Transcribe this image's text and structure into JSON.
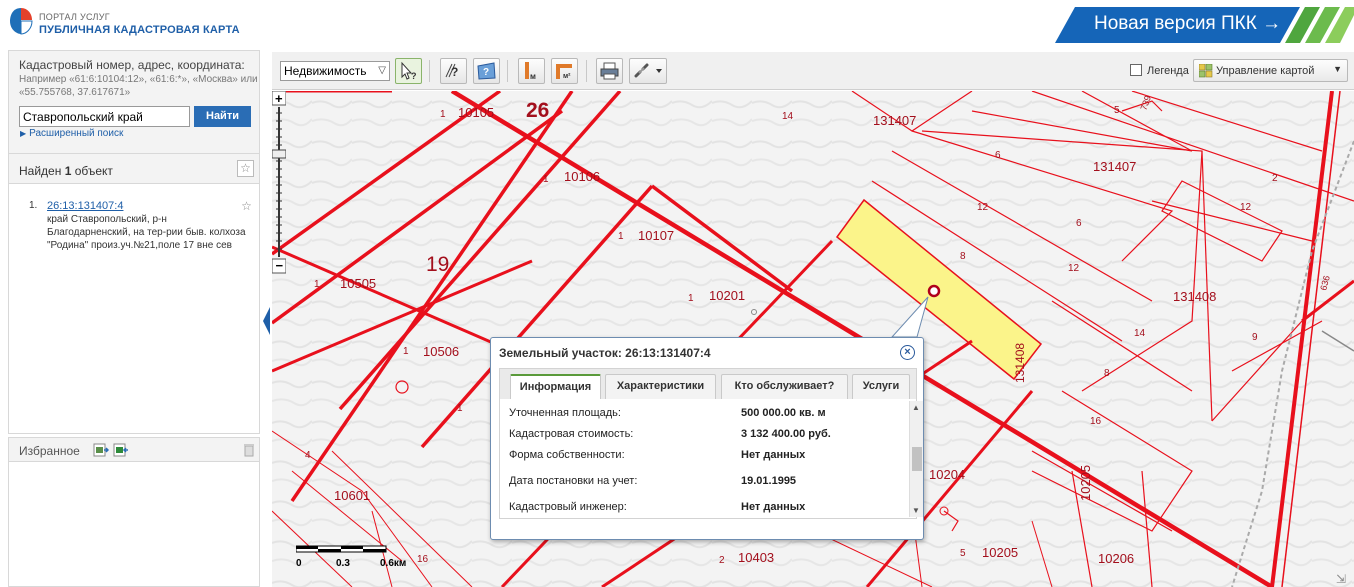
{
  "header": {
    "portal_line1": "ПОРТАЛ УСЛУГ",
    "portal_line2": "ПУБЛИЧНАЯ КАДАСТРОВАЯ КАРТА",
    "banner_label": "Новая версия ПКК →",
    "banner_colors": [
      "#1565b8",
      "#4fa63e"
    ]
  },
  "search": {
    "title": "Кадастровый номер, адрес, координата:",
    "hint": "Например «61:6:10104:12», «61:6:*», «Москва» или «55.755768, 37.617671»",
    "input_value": "Ставропольский край",
    "button_label": "Найти",
    "advanced_label": "Расширенный поиск"
  },
  "results": {
    "title_prefix": "Найден ",
    "count": "1",
    "title_suffix": " объект",
    "items": [
      {
        "num": "1.",
        "cadastral": "26:13:131407:4",
        "address": "край Ставропольский, р-н Благодарненский, на тер-рии быв. колхоза \"Родина\" произ.уч.№21,поле 17 вне сев"
      }
    ]
  },
  "favorites": {
    "title": "Избранное"
  },
  "toolbar": {
    "layer_select": "Недвижимость",
    "legend_label": "Легенда",
    "map_control_label": "Управление картой"
  },
  "map": {
    "labels": [
      {
        "text": "26",
        "big": true
      },
      {
        "text": "19",
        "big": true
      },
      {
        "text": "10105"
      },
      {
        "text": "10106"
      },
      {
        "text": "10107"
      },
      {
        "text": "10201"
      },
      {
        "text": "10505"
      },
      {
        "text": "10506"
      },
      {
        "text": "10601"
      },
      {
        "text": "10204"
      },
      {
        "text": "10205"
      },
      {
        "text": "10205"
      },
      {
        "text": "10206"
      },
      {
        "text": "10403"
      },
      {
        "text": "131407"
      },
      {
        "text": "131407"
      },
      {
        "text": "131408"
      },
      {
        "text": "131408"
      },
      {
        "text": "1"
      },
      {
        "text": "1"
      },
      {
        "text": "1"
      },
      {
        "text": "1"
      },
      {
        "text": "1"
      },
      {
        "text": "1"
      },
      {
        "text": "1"
      },
      {
        "text": "14"
      },
      {
        "text": "14"
      },
      {
        "text": "6"
      },
      {
        "text": "6"
      },
      {
        "text": "12"
      },
      {
        "text": "12"
      },
      {
        "text": "12"
      },
      {
        "text": "8"
      },
      {
        "text": "8"
      },
      {
        "text": "16"
      },
      {
        "text": "5"
      },
      {
        "text": "5"
      },
      {
        "text": "9"
      },
      {
        "text": "4"
      },
      {
        "text": "2"
      },
      {
        "text": "16"
      },
      {
        "text": "739"
      },
      {
        "text": "636"
      },
      {
        "text": "2"
      }
    ],
    "highlight_color": "#fbf48a",
    "line_color": "#e8101c"
  },
  "scale": {
    "t0": "0",
    "t1": "0.3",
    "t2": "0.6км"
  },
  "popup": {
    "title": "Земельный участок: 26:13:131407:4",
    "tabs": [
      "Информация",
      "Характеристики",
      "Кто обслуживает?",
      "Услуги"
    ],
    "rows": [
      {
        "label": "Уточненная площадь:",
        "value": "500 000.00 кв. м"
      },
      {
        "label": "Кадастровая стоимость:",
        "value": "3 132 400.00 руб."
      },
      {
        "label": "Форма собственности:",
        "value": "Нет данных"
      },
      {
        "label": "Дата постановки на учет:",
        "value": "19.01.1995"
      },
      {
        "label": "Кадастровый инженер:",
        "value": "Нет данных"
      }
    ]
  }
}
